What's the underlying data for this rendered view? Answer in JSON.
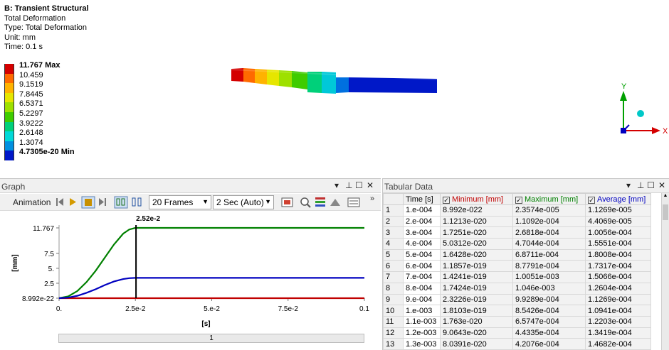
{
  "result_info": {
    "title": "B: Transient Structural",
    "result_name": "Total Deformation",
    "type_line": "Type: Total Deformation",
    "unit_line": "Unit: mm",
    "time_line": "Time: 0.1 s"
  },
  "legend": {
    "entries": [
      {
        "label": "11.767 Max",
        "color": "#d40000"
      },
      {
        "label": "10.459",
        "color": "#ff6a00"
      },
      {
        "label": "9.1519",
        "color": "#ffb300"
      },
      {
        "label": "7.8445",
        "color": "#e6e600"
      },
      {
        "label": "6.5371",
        "color": "#9ee000"
      },
      {
        "label": "5.2297",
        "color": "#3fcc00"
      },
      {
        "label": "3.9222",
        "color": "#00d07a"
      },
      {
        "label": "2.6148",
        "color": "#00d8d8"
      },
      {
        "label": "1.3074",
        "color": "#0090e0"
      },
      {
        "label": "4.7305e-20 Min",
        "color": "#0018c8"
      }
    ]
  },
  "triad": {
    "x_label": "X",
    "y_label": "Y",
    "x_color": "#d40000",
    "y_color": "#00a000",
    "z_color": "#0000c0"
  },
  "graph_panel": {
    "title": "Graph",
    "animation_label": "Animation",
    "frames_select": "20 Frames",
    "duration_select": "2 Sec (Auto)",
    "scroll_label": "1"
  },
  "chart_data": {
    "type": "line",
    "ylabel": "[mm]",
    "xlabel": "[s]",
    "xlim": [
      0,
      0.1
    ],
    "ylim": [
      8.992e-22,
      11.767
    ],
    "x_ticks": [
      {
        "v": 0,
        "label": "0."
      },
      {
        "v": 0.025,
        "label": "2.5e-2"
      },
      {
        "v": 0.05,
        "label": "5.e-2"
      },
      {
        "v": 0.075,
        "label": "7.5e-2"
      },
      {
        "v": 0.1,
        "label": "0.1"
      }
    ],
    "y_ticks": [
      {
        "v": 8.992e-22,
        "label": "8.992e-22"
      },
      {
        "v": 2.5,
        "label": "2.5"
      },
      {
        "v": 5,
        "label": "5."
      },
      {
        "v": 7.5,
        "label": "7.5"
      },
      {
        "v": 11.767,
        "label": "11.767"
      }
    ],
    "cursor": {
      "x": 0.0252,
      "label": "2.52e-2"
    },
    "series": [
      {
        "name": "Minimum [mm]",
        "color": "#c00000",
        "x": [
          0,
          0.1
        ],
        "y": [
          0,
          0
        ]
      },
      {
        "name": "Maximum [mm]",
        "color": "#008000",
        "x": [
          0,
          0.003,
          0.006,
          0.009,
          0.012,
          0.015,
          0.018,
          0.021,
          0.023,
          0.025,
          0.05,
          0.075,
          0.1
        ],
        "y": [
          0,
          0.3,
          1.2,
          2.7,
          4.6,
          6.8,
          9.0,
          10.8,
          11.5,
          11.767,
          11.767,
          11.767,
          11.767
        ]
      },
      {
        "name": "Average [mm]",
        "color": "#0000c0",
        "x": [
          0,
          0.003,
          0.006,
          0.009,
          0.012,
          0.015,
          0.018,
          0.021,
          0.023,
          0.025,
          0.05,
          0.075,
          0.1
        ],
        "y": [
          0,
          0.1,
          0.4,
          0.9,
          1.5,
          2.2,
          2.8,
          3.2,
          3.35,
          3.4,
          3.4,
          3.4,
          3.4
        ]
      }
    ]
  },
  "table_panel": {
    "title": "Tabular Data",
    "headers": {
      "row": "",
      "time": "Time [s]",
      "min": "Minimum [mm]",
      "max": "Maximum [mm]",
      "avg": "Average [mm]"
    },
    "header_colors": {
      "min": "#c00000",
      "max": "#008000",
      "avg": "#0000c0"
    },
    "rows": [
      [
        "1",
        "1.e-004",
        "8.992e-022",
        "2.3574e-005",
        "1.1269e-005"
      ],
      [
        "2",
        "2.e-004",
        "1.1213e-020",
        "1.1092e-004",
        "4.4069e-005"
      ],
      [
        "3",
        "3.e-004",
        "1.7251e-020",
        "2.6818e-004",
        "1.0056e-004"
      ],
      [
        "4",
        "4.e-004",
        "5.0312e-020",
        "4.7044e-004",
        "1.5551e-004"
      ],
      [
        "5",
        "5.e-004",
        "1.6428e-020",
        "6.8711e-004",
        "1.8008e-004"
      ],
      [
        "6",
        "6.e-004",
        "1.1857e-019",
        "8.7791e-004",
        "1.7317e-004"
      ],
      [
        "7",
        "7.e-004",
        "1.4241e-019",
        "1.0051e-003",
        "1.5066e-004"
      ],
      [
        "8",
        "8.e-004",
        "1.7424e-019",
        "1.046e-003",
        "1.2604e-004"
      ],
      [
        "9",
        "9.e-004",
        "2.3226e-019",
        "9.9289e-004",
        "1.1269e-004"
      ],
      [
        "10",
        "1.e-003",
        "1.8103e-019",
        "8.5426e-004",
        "1.0941e-004"
      ],
      [
        "11",
        "1.1e-003",
        "1.763e-020",
        "6.5747e-004",
        "1.2203e-004"
      ],
      [
        "12",
        "1.2e-003",
        "9.0643e-020",
        "4.4335e-004",
        "1.3419e-004"
      ],
      [
        "13",
        "1.3e-003",
        "8.0391e-020",
        "4.2076e-004",
        "1.4682e-004"
      ]
    ]
  }
}
